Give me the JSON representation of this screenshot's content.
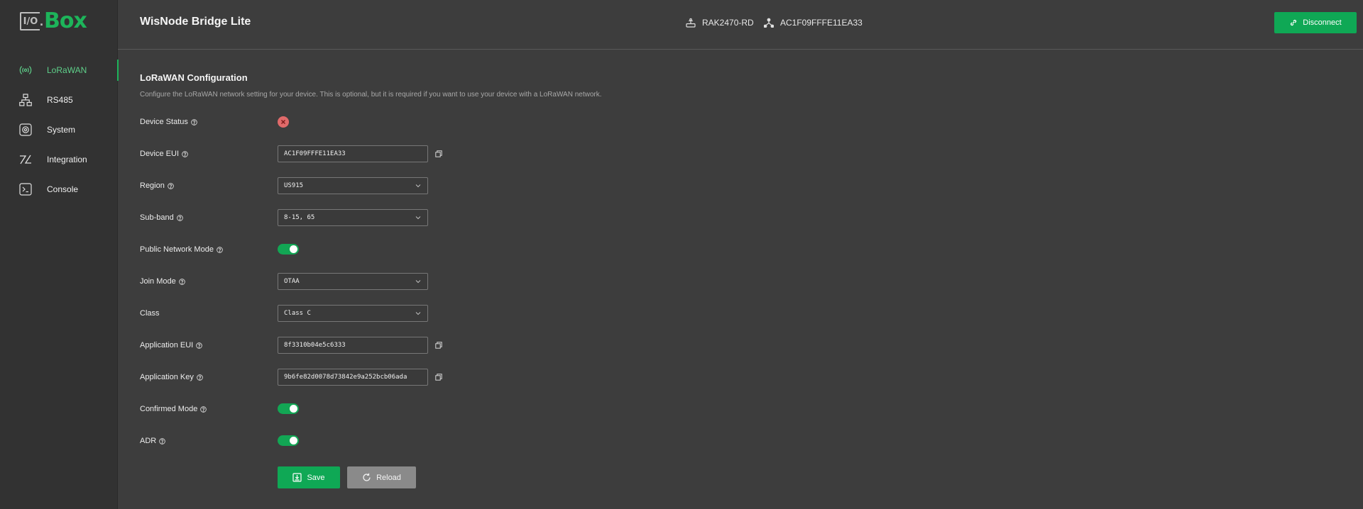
{
  "brand": {
    "logo_io": "I/O",
    "logo_box": "Box"
  },
  "sidebar": {
    "items": [
      {
        "label": "LoRaWAN",
        "icon": "wireless-signal-icon",
        "active": true
      },
      {
        "label": "RS485",
        "icon": "network-tree-icon",
        "active": false
      },
      {
        "label": "System",
        "icon": "settings-chip-icon",
        "active": false
      },
      {
        "label": "Integration",
        "icon": "integration-icon",
        "active": false
      },
      {
        "label": "Console",
        "icon": "terminal-icon",
        "active": false
      }
    ]
  },
  "header": {
    "title": "WisNode Bridge Lite",
    "device_model": "RAK2470-RD",
    "device_eui": "AC1F09FFFE11EA33",
    "disconnect_label": "Disconnect"
  },
  "main": {
    "section_title": "LoRaWAN Configuration",
    "section_desc": "Configure the LoRaWAN network setting for your device. This is optional, but it is required if you want to use your device with a LoRaWAN network.",
    "fields": {
      "device_status": {
        "label": "Device Status",
        "value": "error"
      },
      "device_eui": {
        "label": "Device EUI",
        "value": "AC1F09FFFE11EA33"
      },
      "region": {
        "label": "Region",
        "value": "US915"
      },
      "sub_band": {
        "label": "Sub-band",
        "value": "8-15, 65"
      },
      "public_network_mode": {
        "label": "Public Network Mode",
        "value": true
      },
      "join_mode": {
        "label": "Join Mode",
        "value": "OTAA"
      },
      "class": {
        "label": "Class",
        "value": "Class C"
      },
      "application_eui": {
        "label": "Application EUI",
        "value": "8f3310b04e5c6333"
      },
      "application_key": {
        "label": "Application Key",
        "value": "9b6fe82d0078d73842e9a252bcb06ada"
      },
      "confirmed_mode": {
        "label": "Confirmed Mode",
        "value": true
      },
      "adr": {
        "label": "ADR",
        "value": true
      }
    },
    "save_label": "Save",
    "reload_label": "Reload"
  },
  "colors": {
    "accent": "#0fa855",
    "background": "#3d3d3d",
    "sidebar": "#323232",
    "error": "#e06a6a"
  }
}
